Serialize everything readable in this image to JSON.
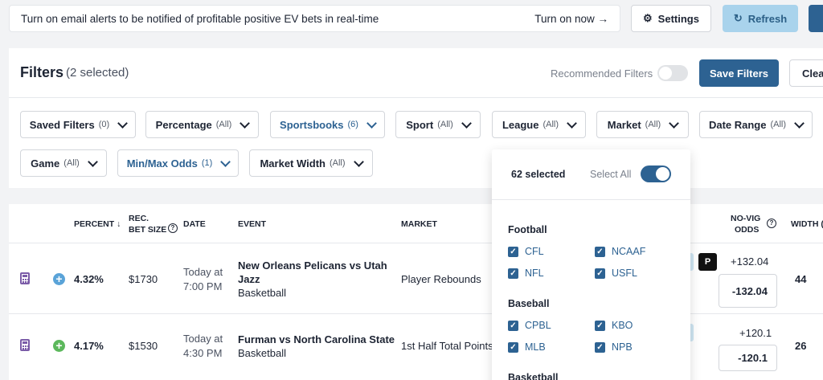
{
  "alert": {
    "text": "Turn on email alerts to be notified of profitable positive EV bets in real-time",
    "cta": "Turn on now →"
  },
  "toolbar": {
    "settings_label": "Settings",
    "refresh_label": "Refresh"
  },
  "filters": {
    "title": "Filters",
    "selected_count": "(2 selected)",
    "recommended_label": "Recommended Filters",
    "recommended_on": false,
    "save_label": "Save Filters",
    "clear_label": "Clea",
    "dropdowns": [
      {
        "label": "Saved Filters",
        "count": "(0)"
      },
      {
        "label": "Percentage",
        "count": "(All)"
      },
      {
        "label": "Sportsbooks",
        "count": "(6)"
      },
      {
        "label": "Sport",
        "count": "(All)"
      },
      {
        "label": "League",
        "count": "(All)"
      },
      {
        "label": "Market",
        "count": "(All)"
      },
      {
        "label": "Date Range",
        "count": "(All)"
      },
      {
        "label": "Game",
        "count": "(All)"
      },
      {
        "label": "Min/Max Odds",
        "count": "(1)"
      },
      {
        "label": "Market Width",
        "count": "(All)"
      }
    ]
  },
  "league_popup": {
    "selected": "62 selected",
    "select_all_label": "Select All",
    "select_all_on": true,
    "groups": [
      {
        "name": "Football",
        "items": [
          "CFL",
          "NCAAF",
          "NFL",
          "USFL"
        ]
      },
      {
        "name": "Baseball",
        "items": [
          "CPBL",
          "KBO",
          "MLB",
          "NPB"
        ]
      },
      {
        "name": "Basketball",
        "items": []
      }
    ]
  },
  "table": {
    "headers": {
      "percent": "PERCENT ↓",
      "rec1": "REC.",
      "rec2": "BET SIZE",
      "date": "DATE",
      "event": "EVENT",
      "market": "MARKET",
      "novig1": "NO-VIG",
      "novig2": "ODDS",
      "width": "WIDTH ("
    },
    "rows": [
      {
        "percent": "4.32%",
        "bet_size": "$1730",
        "date1": "Today at",
        "date2": "7:00 PM",
        "event1": "New Orleans Pelicans vs Utah",
        "event2": "Jazz",
        "sport": "Basketball",
        "market": "Player Rebounds",
        "book_icon": "P",
        "odds_top": "+132.04",
        "odds_box": "-132.04",
        "width": "44",
        "plus_color": "#5aa3d8"
      },
      {
        "percent": "4.17%",
        "bet_size": "$1530",
        "date1": "Today at",
        "date2": "4:30 PM",
        "event1": "Furman vs North Carolina State",
        "event2": "",
        "sport": "Basketball",
        "market": "1st Half Total Points",
        "book_icon": "",
        "odds_top": "+120.1",
        "odds_box": "-120.1",
        "width": "26",
        "plus_color": "#5cb85c"
      }
    ]
  }
}
